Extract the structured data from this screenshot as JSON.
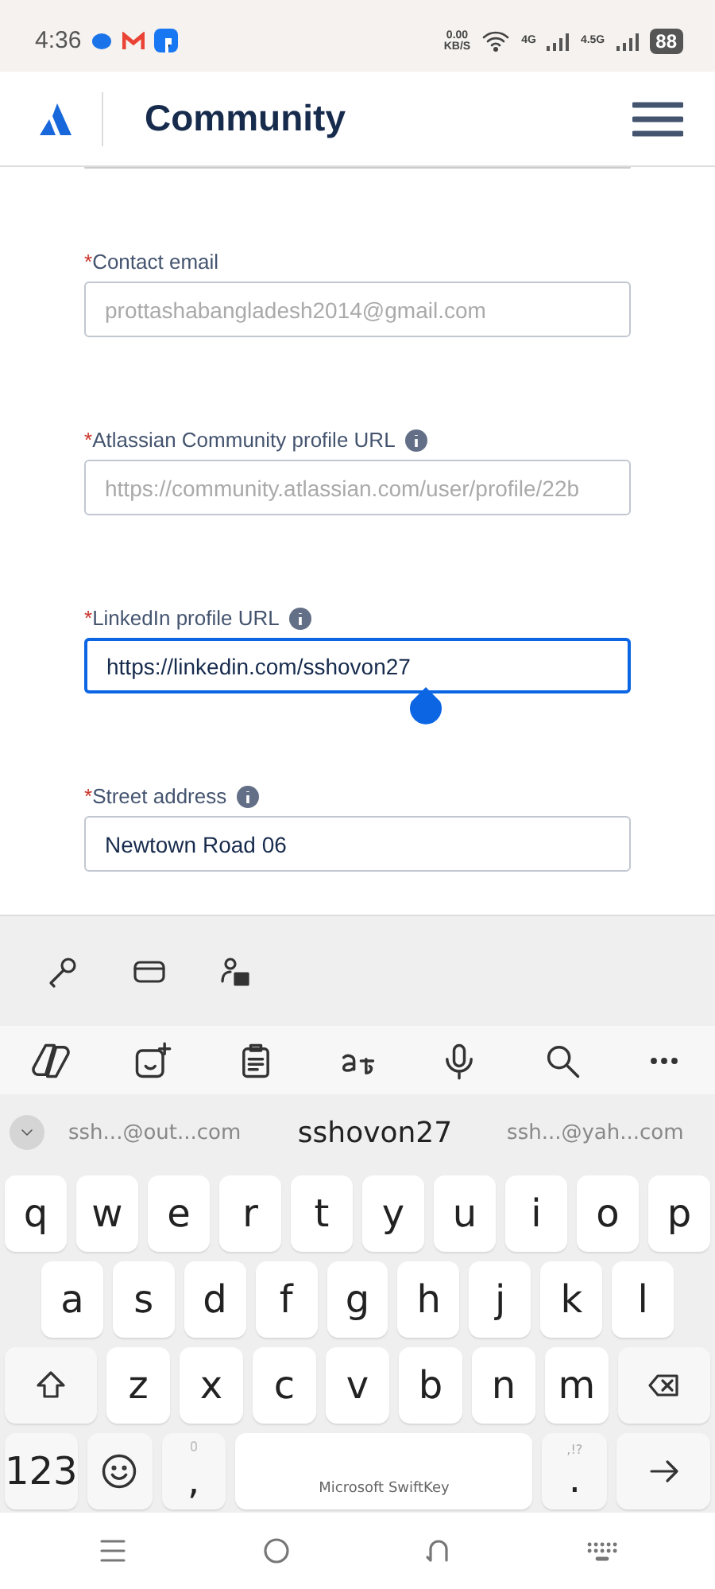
{
  "status_bar": {
    "time": "4:36",
    "speed_value": "0.00",
    "speed_unit": "KB/S",
    "net1": "4G",
    "net2": "4.5G",
    "battery": "88"
  },
  "header": {
    "title": "Community"
  },
  "form": {
    "fields": [
      {
        "label": "Contact email",
        "required_mark": "*",
        "info": false,
        "value": "prottashabangladesh2014@gmail.com",
        "disabled": true,
        "focused": false
      },
      {
        "label": "Atlassian Community profile URL",
        "required_mark": "*",
        "info": true,
        "value": "https://community.atlassian.com/user/profile/22b",
        "disabled": true,
        "focused": false
      },
      {
        "label": "LinkedIn profile URL",
        "required_mark": "*",
        "info": true,
        "value": "https://linkedin.com/sshovon27",
        "disabled": false,
        "focused": true
      },
      {
        "label": "Street address",
        "required_mark": "*",
        "info": true,
        "value": "Newtown Road 06",
        "disabled": false,
        "focused": false
      }
    ]
  },
  "keyboard": {
    "suggestions": [
      {
        "text": "ssh...@out...com",
        "selected": false
      },
      {
        "text": "sshovon27",
        "selected": true
      },
      {
        "text": "ssh...@yah...com",
        "selected": false
      }
    ],
    "rows": [
      {
        "keys": [
          {
            "kind": "letter",
            "label": "q"
          },
          {
            "kind": "letter",
            "label": "w"
          },
          {
            "kind": "letter",
            "label": "e"
          },
          {
            "kind": "letter",
            "label": "r"
          },
          {
            "kind": "letter",
            "label": "t"
          },
          {
            "kind": "letter",
            "label": "y"
          },
          {
            "kind": "letter",
            "label": "u"
          },
          {
            "kind": "letter",
            "label": "i"
          },
          {
            "kind": "letter",
            "label": "o"
          },
          {
            "kind": "letter",
            "label": "p"
          }
        ]
      },
      {
        "keys": [
          {
            "kind": "letter",
            "label": "a"
          },
          {
            "kind": "letter",
            "label": "s"
          },
          {
            "kind": "letter",
            "label": "d"
          },
          {
            "kind": "letter",
            "label": "f"
          },
          {
            "kind": "letter",
            "label": "g"
          },
          {
            "kind": "letter",
            "label": "h"
          },
          {
            "kind": "letter",
            "label": "j"
          },
          {
            "kind": "letter",
            "label": "k"
          },
          {
            "kind": "letter",
            "label": "l"
          }
        ]
      },
      {
        "keys": [
          {
            "kind": "shift"
          },
          {
            "kind": "letter",
            "label": "z"
          },
          {
            "kind": "letter",
            "label": "x"
          },
          {
            "kind": "letter",
            "label": "c"
          },
          {
            "kind": "letter",
            "label": "v"
          },
          {
            "kind": "letter",
            "label": "b"
          },
          {
            "kind": "letter",
            "label": "n"
          },
          {
            "kind": "letter",
            "label": "m"
          },
          {
            "kind": "backspace"
          }
        ]
      },
      {
        "keys": [
          {
            "kind": "numbers",
            "label": "123"
          },
          {
            "kind": "emoji"
          },
          {
            "kind": "comma",
            "label": ","
          },
          {
            "kind": "space",
            "label": "Microsoft SwiftKey"
          },
          {
            "kind": "period",
            "label": ".",
            "hint": ",!?"
          },
          {
            "kind": "enter"
          }
        ]
      }
    ]
  }
}
